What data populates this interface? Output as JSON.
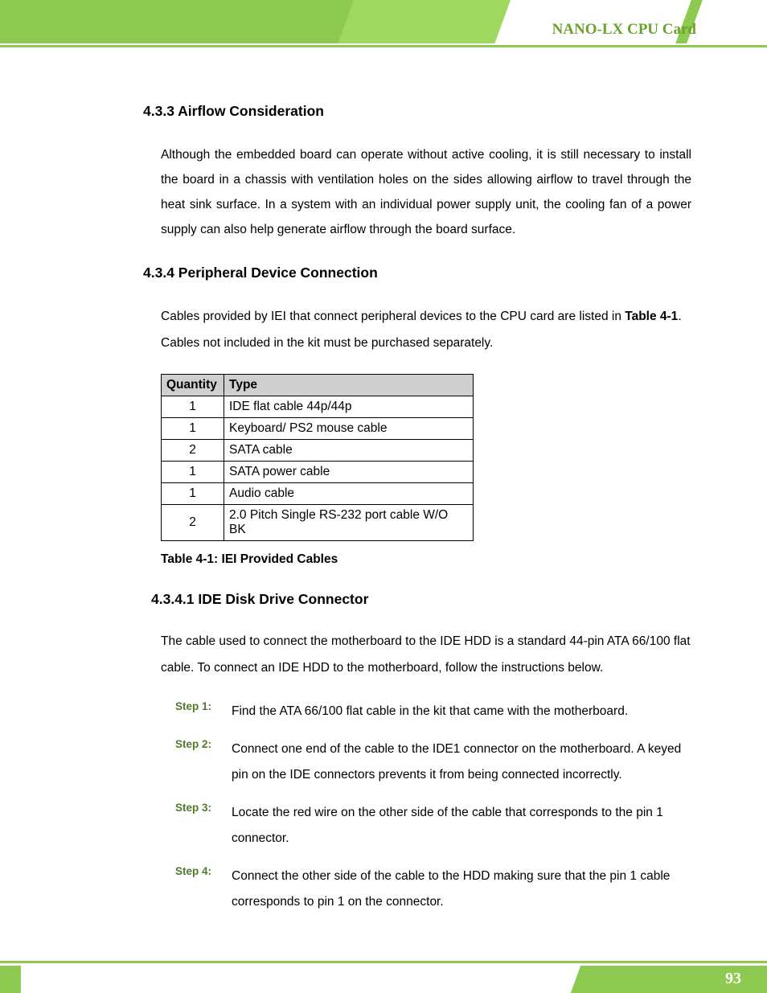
{
  "header": {
    "title": "NANO-LX CPU Card"
  },
  "footer": {
    "page_number": "93"
  },
  "section_433": {
    "heading": "4.3.3 Airflow Consideration",
    "paragraph": "Although the embedded board can operate without active cooling, it is still necessary to install the board in a chassis with ventilation holes on the sides allowing airflow to travel through the heat sink surface. In a system with an individual power supply unit, the cooling fan of a power supply can also help generate airflow through the board surface."
  },
  "section_434": {
    "heading": "4.3.4 Peripheral Device Connection",
    "intro_pre": "Cables provided by IEI that connect peripheral devices to the CPU card are listed in ",
    "intro_ref": "Table 4-1",
    "intro_post": ". Cables not included in the kit must be purchased separately.",
    "table": {
      "headers": {
        "qty": "Quantity",
        "type": "Type"
      },
      "rows": [
        {
          "qty": "1",
          "type": "IDE flat cable 44p/44p"
        },
        {
          "qty": "1",
          "type": "Keyboard/ PS2 mouse cable"
        },
        {
          "qty": "2",
          "type": "SATA cable"
        },
        {
          "qty": "1",
          "type": "SATA power cable"
        },
        {
          "qty": "1",
          "type": "Audio cable"
        },
        {
          "qty": "2",
          "type": "2.0 Pitch Single RS-232 port cable W/O BK"
        }
      ]
    },
    "table_caption": "Table 4-1: IEI Provided Cables"
  },
  "section_4341": {
    "heading": "4.3.4.1 IDE Disk Drive Connector",
    "paragraph": "The cable used to connect the motherboard to the IDE HDD is a standard 44-pin ATA 66/100 flat cable. To connect an IDE HDD to the motherboard, follow the instructions below.",
    "steps": [
      {
        "label": "Step 1:",
        "text": "Find the ATA 66/100 flat cable in the kit that came with the motherboard."
      },
      {
        "label": "Step 2:",
        "text": "Connect one end of the cable to the IDE1 connector on the motherboard. A keyed pin on the IDE connectors prevents it from being connected incorrectly."
      },
      {
        "label": "Step 3:",
        "text": "Locate the red wire on the other side of the cable that corresponds to the pin 1 connector."
      },
      {
        "label": "Step 4:",
        "text": "Connect the other side of the cable to the HDD making sure that the pin 1 cable corresponds to pin 1 on the connector."
      }
    ]
  }
}
